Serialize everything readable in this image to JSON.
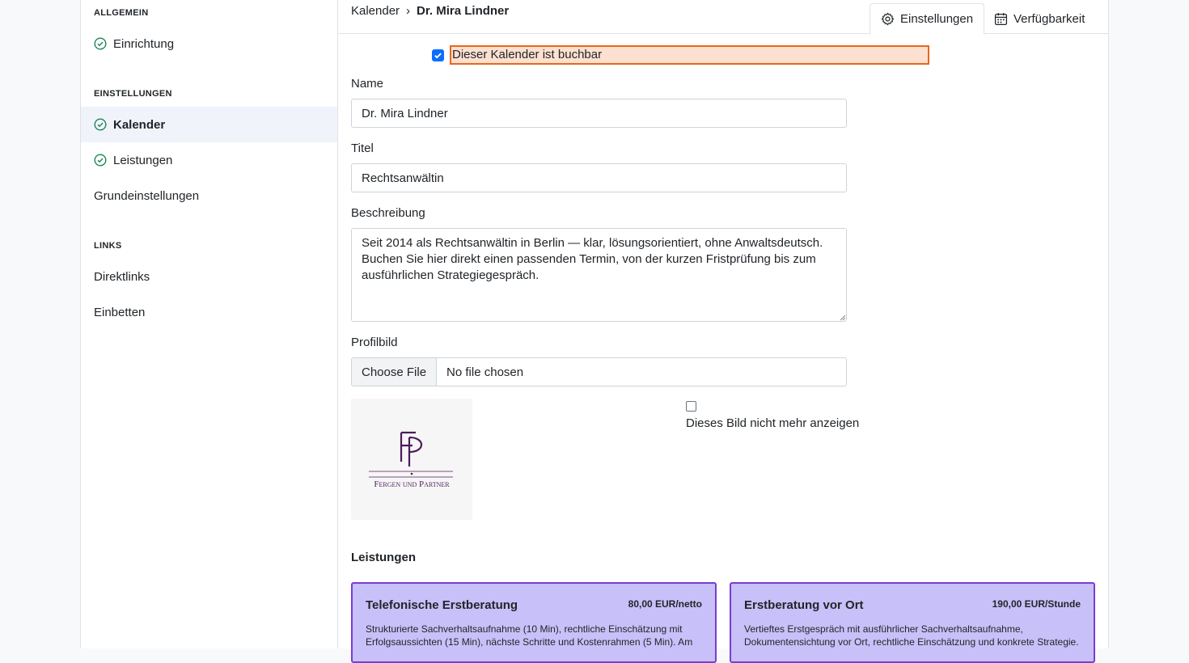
{
  "sidebar": {
    "sections": [
      {
        "title": "ALLGEMEIN",
        "items": [
          {
            "label": "Einrichtung"
          }
        ]
      },
      {
        "title": "EINSTELLUNGEN",
        "items": [
          {
            "label": "Kalender"
          },
          {
            "label": "Leistungen"
          },
          {
            "label": "Grundeinstellungen"
          }
        ]
      },
      {
        "title": "LINKS",
        "items": [
          {
            "label": "Direktlinks"
          },
          {
            "label": "Einbetten"
          }
        ]
      }
    ]
  },
  "breadcrumb": {
    "parent": "Kalender",
    "separator": "›",
    "current": "Dr. Mira Lindner"
  },
  "tabs": [
    {
      "label": "Einstellungen",
      "icon": "gear-icon"
    },
    {
      "label": "Verfügbarkeit",
      "icon": "calendar-icon"
    }
  ],
  "form": {
    "bookable_label": "Dieser Kalender ist buchbar",
    "bookable_checked": true,
    "name_label": "Name",
    "name_value": "Dr. Mira Lindner",
    "title_label": "Titel",
    "title_value": "Rechtsanwältin",
    "description_label": "Beschreibung",
    "description_value": "Seit 2014 als Rechtsanwältin in Berlin — klar, lösungsorientiert, ohne Anwaltsdeutsch. Buchen Sie hier direkt einen passenden Termin, von der kurzen Fristprüfung bis zum ausführlichen Strategiegespräch.",
    "image_label": "Profilbild",
    "file_button": "Choose File",
    "file_status": "No file chosen",
    "hide_image_label": "Dieses Bild nicht mehr anzeigen",
    "hide_image_checked": false
  },
  "logo": {
    "monogram": "FP",
    "text": "Fergen und Partner",
    "color": "#4b1c5a"
  },
  "services": {
    "heading": "Leistungen",
    "cards": [
      {
        "title": "Telefonische Erstberatung",
        "price": "80,00 EUR/netto",
        "description": "Strukturierte Sachverhaltsaufnahme (10 Min), rechtliche Einschätzung mit Erfolgsaussichten (15 Min), nächste Schritte und Kostenrahmen (5 Min). Am"
      },
      {
        "title": "Erstberatung vor Ort",
        "price": "190,00 EUR/Stunde",
        "description": "Vertieftes Erstgespräch mit ausführlicher Sachverhaltsaufnahme, Dokumentensichtung vor Ort, rechtliche Einschätzung und konkrete Strategie."
      }
    ]
  },
  "colors": {
    "accent": "#0d6efd",
    "highlight_border": "#e8671b",
    "card_bg": "#c8c0f8",
    "card_border": "#7a3dd0",
    "check_green": "#198754"
  }
}
